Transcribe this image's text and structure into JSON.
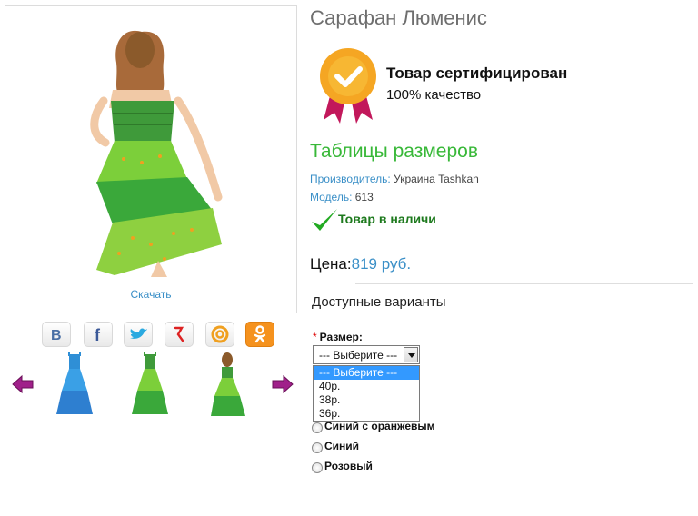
{
  "gallery": {
    "download_label": "Скачать",
    "social": [
      "vk-icon",
      "facebook-icon",
      "twitter-icon",
      "odnoklassniki-icon",
      "mailru-icon",
      "ok-icon"
    ],
    "thumbnails": [
      "blue-dress",
      "green-dress",
      "girl-back-view"
    ]
  },
  "product": {
    "title": "Сарафан Люменис",
    "certificate": {
      "title": "Товар сертифицирован",
      "subtitle": "100% качество"
    },
    "size_tables_link": "Таблицы размеров",
    "manufacturer_label": "Производитель:",
    "manufacturer": "Украина Tashkan",
    "model_label": "Модель:",
    "model": "613",
    "stock": "Товар в наличи",
    "price_label": "Цена:",
    "price": "819 руб."
  },
  "variants": {
    "title": "Доступные варианты",
    "size_label": "Размер:",
    "required_mark": "*",
    "size_selected": "--- Выберите ---",
    "size_options": [
      "--- Выберите ---",
      "40р.",
      "38р.",
      "36р."
    ],
    "colors": [
      "Синий с оранжевым",
      "Синий",
      "Розовый"
    ]
  },
  "colors": {
    "link": "#3a8fc7",
    "accent_green": "#38b838",
    "stock_green": "#1e7a1e"
  }
}
